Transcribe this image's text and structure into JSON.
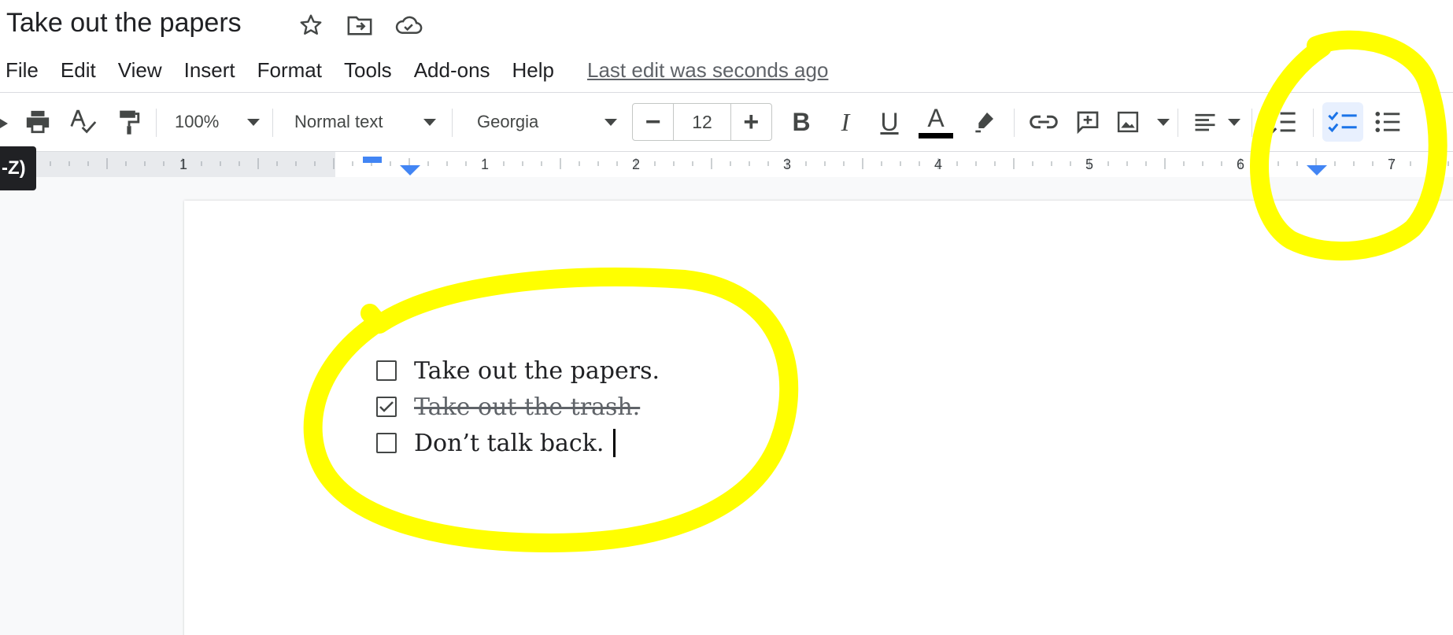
{
  "title": "Take out the papers",
  "menu": {
    "items": [
      "File",
      "Edit",
      "View",
      "Insert",
      "Format",
      "Tools",
      "Add-ons",
      "Help"
    ],
    "last_edit": "Last edit was seconds ago"
  },
  "toolbar": {
    "zoom": "100%",
    "style": "Normal text",
    "font": "Georgia",
    "font_size": "12",
    "minus": "−",
    "plus": "+",
    "bold": "B",
    "italic": "I",
    "underline": "U",
    "text_color_label": "A"
  },
  "ruler": {
    "marks": [
      "1",
      "1",
      "2",
      "3",
      "4",
      "5",
      "6",
      "7"
    ]
  },
  "tooltip": "-Z)",
  "document": {
    "checklist": [
      {
        "text": "Take out the papers.",
        "checked": false
      },
      {
        "text": "Take out the trash.",
        "checked": true
      },
      {
        "text": "Don’t talk back.",
        "checked": false
      }
    ]
  },
  "colors": {
    "highlight": "#ffff00",
    "accent": "#1a73e8"
  }
}
